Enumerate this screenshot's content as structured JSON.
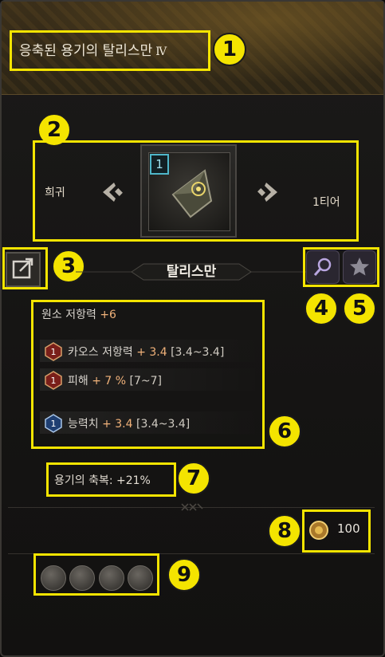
{
  "header": {
    "item_name": "응축된 용기의 탈리스만",
    "item_tier_roman": "Ⅳ"
  },
  "item": {
    "rarity": "희귀",
    "tier": "1티어",
    "level": "1",
    "type": "탈리스만"
  },
  "stats": {
    "base": {
      "label": "원소 저항력",
      "value": "+6"
    },
    "lines": [
      {
        "badge": "1",
        "label": "카오스 저항력",
        "value": "+ 3.4",
        "range": "[3.4~3.4]",
        "gem_color": "#c0392b"
      },
      {
        "badge": "1",
        "label": "피해",
        "value": "+ 7 %",
        "range": "[7~7]",
        "gem_color": "#c0392b"
      },
      {
        "badge": "1",
        "label": "능력치",
        "value": "+ 3.4",
        "range": "[3.4~3.4]",
        "gem_color": "#3a6fb0"
      }
    ]
  },
  "blessing": "용기의 축복: +21%",
  "gold": {
    "value": "100",
    "icon": "gold-coin-icon"
  },
  "utilities": [
    "pouch-icon",
    "scroll-icon",
    "crossed-tools-icon",
    "pliers-icon"
  ],
  "annotations": [
    "1",
    "2",
    "3",
    "4",
    "5",
    "6",
    "7",
    "8",
    "9"
  ],
  "colors": {
    "highlight": "#f4e400",
    "stat_value": "#f1b27a",
    "level_badge": "#4fb6c9"
  }
}
